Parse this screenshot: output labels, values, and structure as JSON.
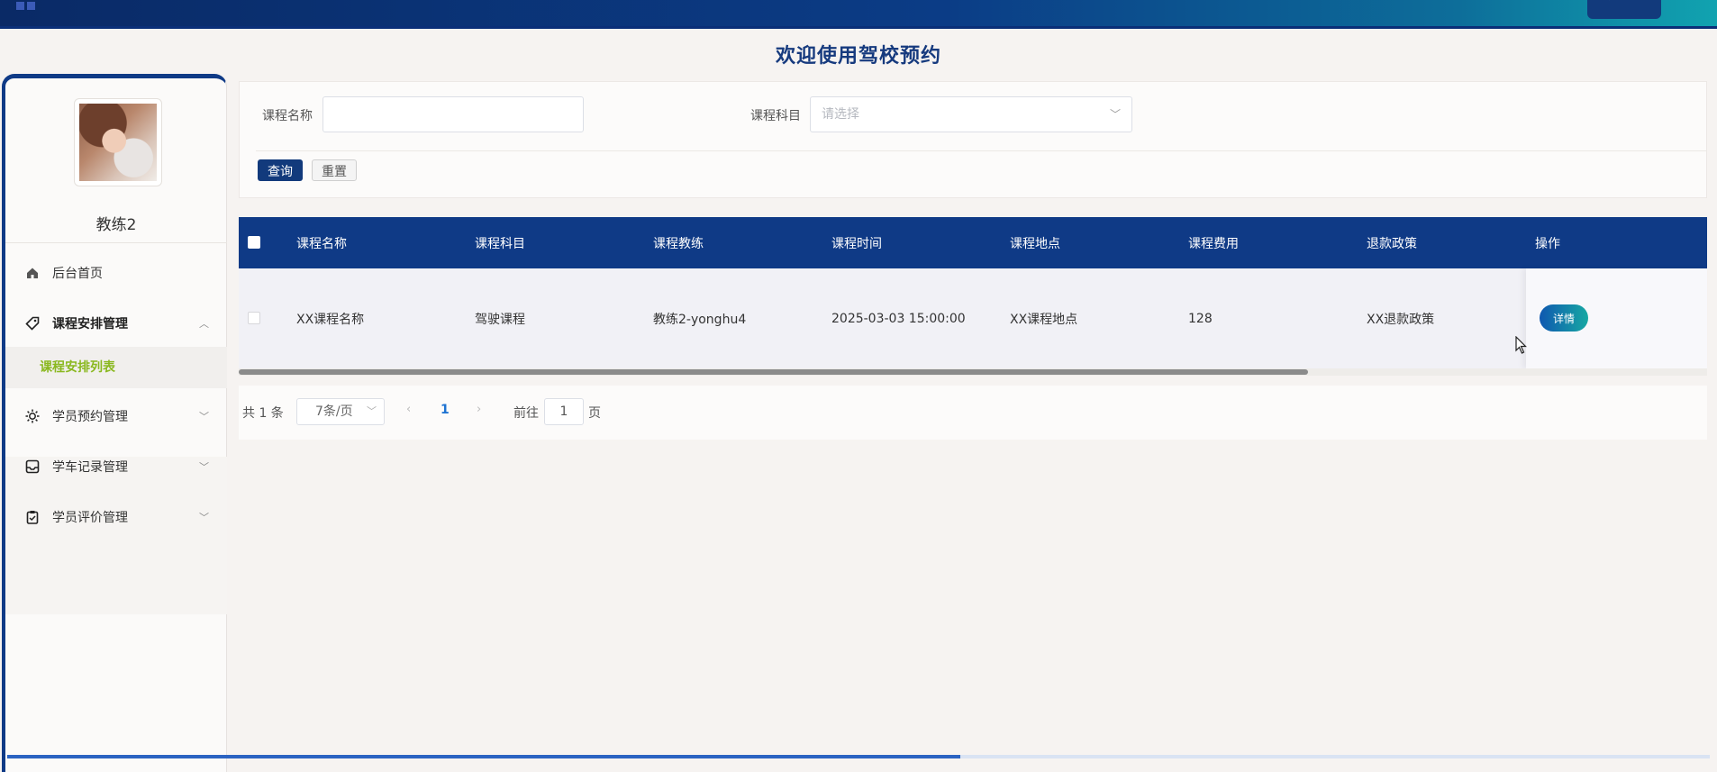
{
  "header": {
    "user_menu_label": "教练2",
    "page_title": "欢迎使用驾校预约"
  },
  "sidebar": {
    "username": "教练2",
    "items": [
      {
        "label": "后台首页",
        "icon": "home-icon"
      },
      {
        "label": "课程安排管理",
        "icon": "tag-icon",
        "expanded": true
      },
      {
        "label": "课程安排列表",
        "sub": true,
        "active": true
      },
      {
        "label": "学员预约管理",
        "icon": "sun-icon"
      },
      {
        "label": "学车记录管理",
        "icon": "inbox-icon"
      },
      {
        "label": "学员评价管理",
        "icon": "clipboard-icon"
      }
    ]
  },
  "search": {
    "name_label": "课程名称",
    "name_value": "",
    "subject_label": "课程科目",
    "subject_placeholder": "请选择",
    "query_label": "查询",
    "reset_label": "重置"
  },
  "table": {
    "columns": [
      "课程名称",
      "课程科目",
      "课程教练",
      "课程时间",
      "课程地点",
      "课程费用",
      "退款政策",
      "操作"
    ],
    "rows": [
      [
        "XX课程名称",
        "驾驶课程",
        "教练2-yonghu4",
        "2025-03-03 15:00:00",
        "XX课程地点",
        "128",
        "XX退款政策"
      ]
    ],
    "detail_label": "详情"
  },
  "pagination": {
    "total_text": "共 1 条",
    "page_size_text": "7条/页",
    "current_page": "1",
    "goto_prefix": "前往",
    "goto_value": "1",
    "goto_suffix": "页"
  },
  "colors": {
    "primary": "#0f3a86",
    "accent_green": "#8ab81f"
  }
}
